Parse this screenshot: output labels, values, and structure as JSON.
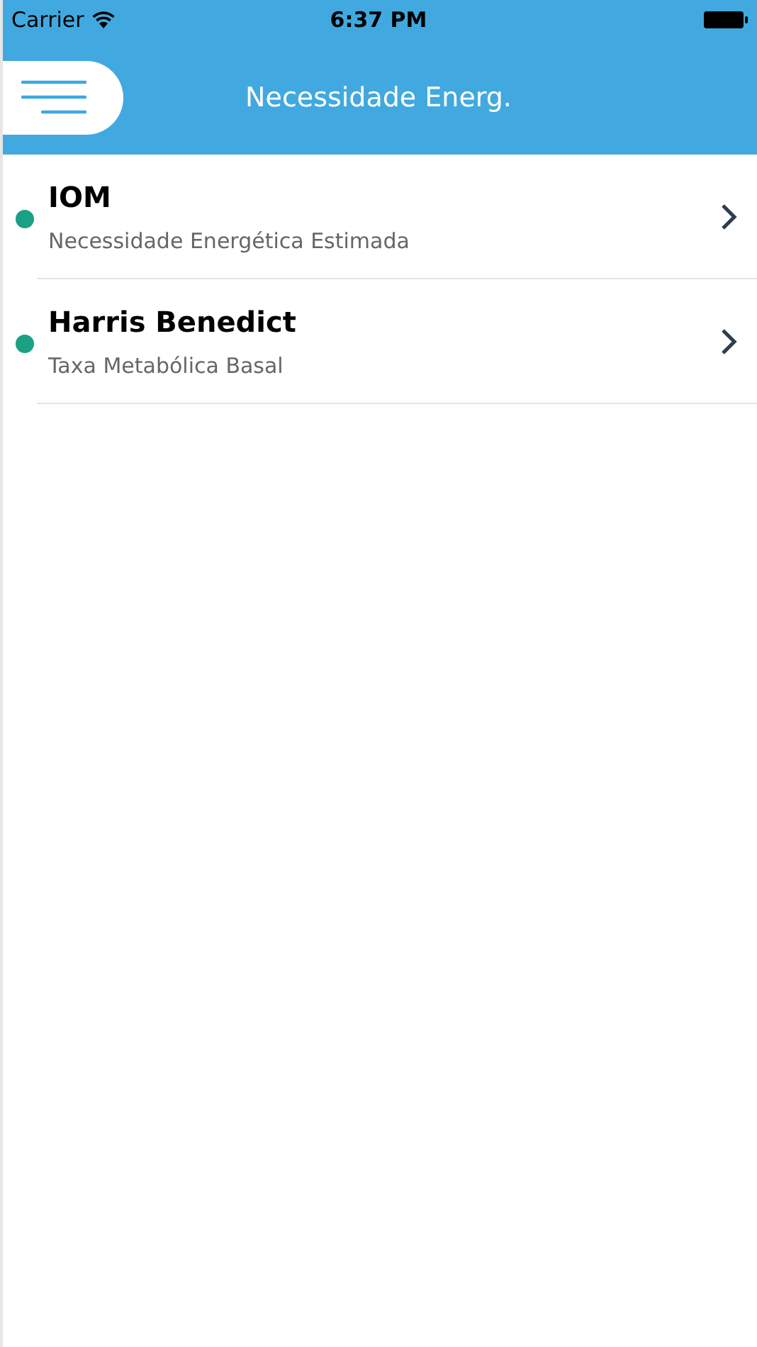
{
  "status_bar": {
    "carrier": "Carrier",
    "time": "6:37 PM"
  },
  "nav": {
    "title": "Necessidade Energ."
  },
  "items": [
    {
      "title": "IOM",
      "subtitle": "Necessidade Energética Estimada",
      "color": "#19a085"
    },
    {
      "title": "Harris Benedict",
      "subtitle": "Taxa Metabólica Basal",
      "color": "#19a085"
    }
  ]
}
